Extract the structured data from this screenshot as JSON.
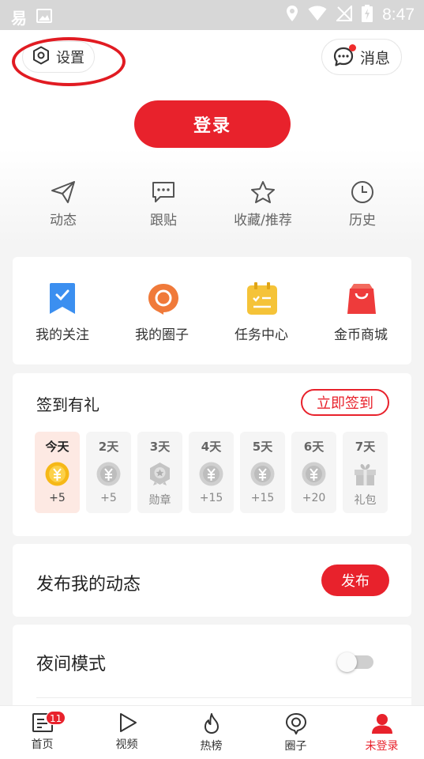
{
  "status_bar": {
    "time": "8:47",
    "app_glyph": "易"
  },
  "header": {
    "settings_label": "设置",
    "messages_label": "消息",
    "login_label": "登录"
  },
  "quick_links": [
    {
      "label": "动态",
      "icon": "send-icon"
    },
    {
      "label": "跟贴",
      "icon": "comment-icon"
    },
    {
      "label": "收藏/推荐",
      "icon": "star-icon"
    },
    {
      "label": "历史",
      "icon": "clock-icon"
    }
  ],
  "services": [
    {
      "label": "我的关注",
      "icon": "bookmark-icon",
      "color": "#3b8ff0"
    },
    {
      "label": "我的圈子",
      "icon": "circle-chat-icon",
      "color": "#f07a3a"
    },
    {
      "label": "任务中心",
      "icon": "task-icon",
      "color": "#f5c338"
    },
    {
      "label": "金币商城",
      "icon": "shopping-bag-icon",
      "color": "#ee3b3b"
    }
  ],
  "sign_in": {
    "title": "签到有礼",
    "button": "立即签到",
    "days": [
      {
        "label": "今天",
        "reward": "+5",
        "icon": "gold-coin-icon"
      },
      {
        "label": "2天",
        "reward": "+5",
        "icon": "coin-icon"
      },
      {
        "label": "3天",
        "reward": "勋章",
        "icon": "medal-icon"
      },
      {
        "label": "4天",
        "reward": "+15",
        "icon": "coin-icon"
      },
      {
        "label": "5天",
        "reward": "+15",
        "icon": "coin-icon"
      },
      {
        "label": "6天",
        "reward": "+20",
        "icon": "coin-icon"
      },
      {
        "label": "7天",
        "reward": "礼包",
        "icon": "gift-icon"
      }
    ]
  },
  "publish": {
    "title": "发布我的动态",
    "button": "发布"
  },
  "night_mode": {
    "title": "夜间模式",
    "enabled": false
  },
  "bottom_nav": [
    {
      "label": "首页",
      "icon": "news-icon",
      "badge": "11"
    },
    {
      "label": "视频",
      "icon": "play-icon"
    },
    {
      "label": "热榜",
      "icon": "flame-icon"
    },
    {
      "label": "圈子",
      "icon": "location-circle-icon"
    },
    {
      "label": "未登录",
      "icon": "user-icon",
      "active": true
    }
  ],
  "colors": {
    "accent": "#e8222c"
  }
}
